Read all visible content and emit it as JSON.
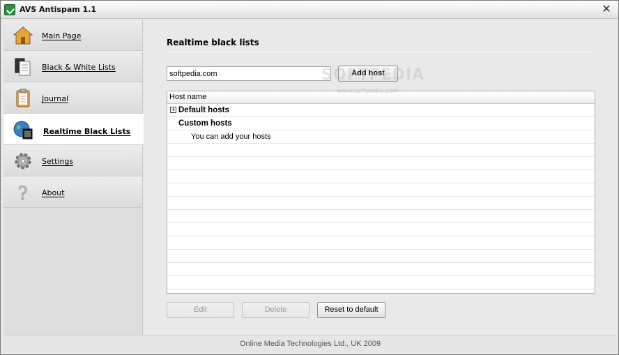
{
  "window": {
    "title": "AVS Antispam 1.1",
    "close_glyph": "✕"
  },
  "sidebar": {
    "items": [
      {
        "label": "Main Page",
        "icon": "home-icon"
      },
      {
        "label": "Black & White Lists",
        "icon": "document-list-icon"
      },
      {
        "label": "Journal",
        "icon": "clipboard-icon"
      },
      {
        "label": "Realtime Black Lists",
        "icon": "globe-list-icon",
        "active": true
      },
      {
        "label": "Settings",
        "icon": "gear-icon"
      },
      {
        "label": "About",
        "icon": "question-mark-icon"
      }
    ]
  },
  "main": {
    "title": "Realtime black lists",
    "host_input": {
      "value": "softpedia.com",
      "placeholder": ""
    },
    "add_host_label": "Add host",
    "grid": {
      "header": "Host name",
      "rows": [
        {
          "text": "Default hosts",
          "type": "group",
          "expander": "+"
        },
        {
          "text": "Custom hosts",
          "type": "group"
        },
        {
          "text": "You can add your hosts",
          "type": "item"
        }
      ]
    },
    "buttons": {
      "edit": "Edit",
      "delete": "Delete",
      "reset": "Reset to default"
    }
  },
  "footer": "Online Media Technologies Ltd., UK 2009",
  "watermark": {
    "big": "SOFTPEDIA",
    "small": "www.softpedia.com"
  },
  "colors": {
    "active_bg": "#ffffff",
    "sidebar_bg": "#dedede",
    "main_bg": "#e9e9e9"
  }
}
